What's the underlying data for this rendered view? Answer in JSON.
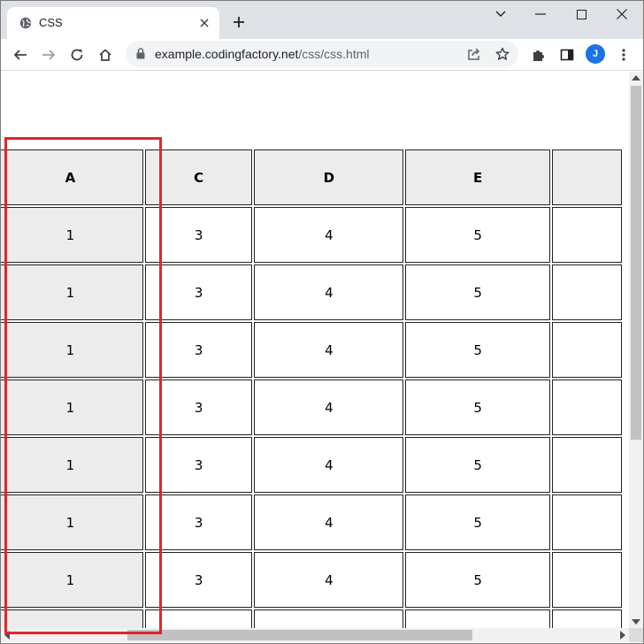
{
  "browser": {
    "tab_title": "CSS",
    "url_host": "example.codingfactory.net",
    "url_path": "/css/css.html",
    "profile_initial": "J",
    "accent_color": "#1a73e8"
  },
  "icons": {
    "tab": "globe-icon",
    "close": "close-icon",
    "new_tab": "plus-icon",
    "back": "back-arrow-icon",
    "forward": "forward-arrow-icon",
    "reload": "reload-icon",
    "home": "home-icon",
    "lock": "lock-icon",
    "share": "share-icon",
    "bookmark": "star-icon",
    "extensions": "puzzle-icon",
    "side_panel": "side-panel-icon",
    "menu": "kebab-menu-icon"
  },
  "table": {
    "headers": [
      "A",
      "C",
      "D",
      "E",
      ""
    ],
    "rows": [
      [
        "1",
        "3",
        "4",
        "5",
        ""
      ],
      [
        "1",
        "3",
        "4",
        "5",
        ""
      ],
      [
        "1",
        "3",
        "4",
        "5",
        ""
      ],
      [
        "1",
        "3",
        "4",
        "5",
        ""
      ],
      [
        "1",
        "3",
        "4",
        "5",
        ""
      ],
      [
        "1",
        "3",
        "4",
        "5",
        ""
      ],
      [
        "1",
        "3",
        "4",
        "5",
        ""
      ],
      [
        "",
        "",
        "",
        "",
        ""
      ]
    ]
  },
  "highlight_color": "#e0262e"
}
